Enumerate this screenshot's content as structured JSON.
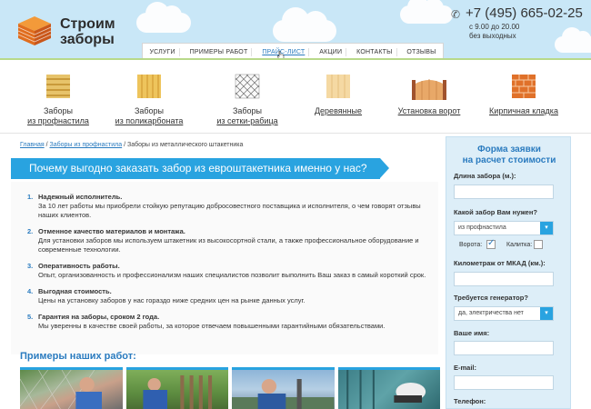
{
  "header": {
    "brand": "Строим заборы",
    "phone": "+7 (495) 665-02-25",
    "hours_line1": "с 9.00 до 20.00",
    "hours_line2": "без выходных"
  },
  "nav": {
    "items": [
      {
        "label": "УСЛУГИ"
      },
      {
        "label": "ПРИМЕРЫ РАБОТ"
      },
      {
        "label": "ПРАЙС-ЛИСТ"
      },
      {
        "label": "АКЦИИ"
      },
      {
        "label": "КОНТАКТЫ"
      },
      {
        "label": "ОТЗЫВЫ"
      }
    ],
    "active_index": 2
  },
  "categories": [
    {
      "line1": "Заборы",
      "line2": "из профнастила",
      "icon": "profnastil-icon"
    },
    {
      "line1": "Заборы",
      "line2": "из поликарбоната",
      "icon": "polycarbonate-icon"
    },
    {
      "line1": "Заборы",
      "line2": "из сетки-рабица",
      "icon": "mesh-icon"
    },
    {
      "line1": "",
      "line2": "Деревянные",
      "icon": "wood-fence-icon"
    },
    {
      "line1": "",
      "line2": "Установка ворот",
      "icon": "gate-icon"
    },
    {
      "line1": "",
      "line2": "Кирпичная кладка",
      "icon": "brick-icon"
    }
  ],
  "breadcrumb": {
    "home": "Главная",
    "sep": " / ",
    "parent": "Заборы из профнастила",
    "current": "Заборы из металлического штакетника"
  },
  "banner": "Почему выгодно заказать забор из евроштакетника именно у нас?",
  "reasons": [
    {
      "num": "1.",
      "title": "Надежный исполнитель.",
      "text": "За 10 лет работы мы приобрели стойкую репутацию добросовестного поставщика и исполнителя, о чем говорят отзывы наших клиентов."
    },
    {
      "num": "2.",
      "title": "Отменное качество материалов и монтажа.",
      "text": "Для установки заборов мы используем штакетник из высокосортной стали, а также профессиональное оборудование и современные технологии."
    },
    {
      "num": "3.",
      "title": "Оперативность работы.",
      "text": "Опыт, организованность и профессионализм наших специалистов позволит выполнить Ваш заказ в самый короткий срок."
    },
    {
      "num": "4.",
      "title": "Выгодная стоимость.",
      "text": "Цены на установку заборов у нас гораздо ниже средних цен на рынке данных услуг."
    },
    {
      "num": "5.",
      "title": "Гарантия на заборы, сроком 2 года.",
      "text": "Мы уверенны в качестве своей работы, за которое отвечаем повышенными гарантийными обязательствами."
    }
  ],
  "examples_title": "Примеры наших работ:",
  "form": {
    "title_line1": "Форма заявки",
    "title_line2": "на расчет стоимости",
    "length_label": "Длина забора (м.):",
    "fence_type_label": "Какой забор Вам нужен?",
    "fence_type_value": "из профнастила",
    "gate_label": "Ворота:",
    "wicket_label": "Калитка:",
    "gate_checked": true,
    "wicket_checked": false,
    "mkad_label": "Километраж от МКАД (км.):",
    "generator_label": "Требуется генератор?",
    "generator_value": "да, электричества нет",
    "name_label": "Ваше имя:",
    "email_label": "E-mail:",
    "phone_label": "Телефон:"
  }
}
